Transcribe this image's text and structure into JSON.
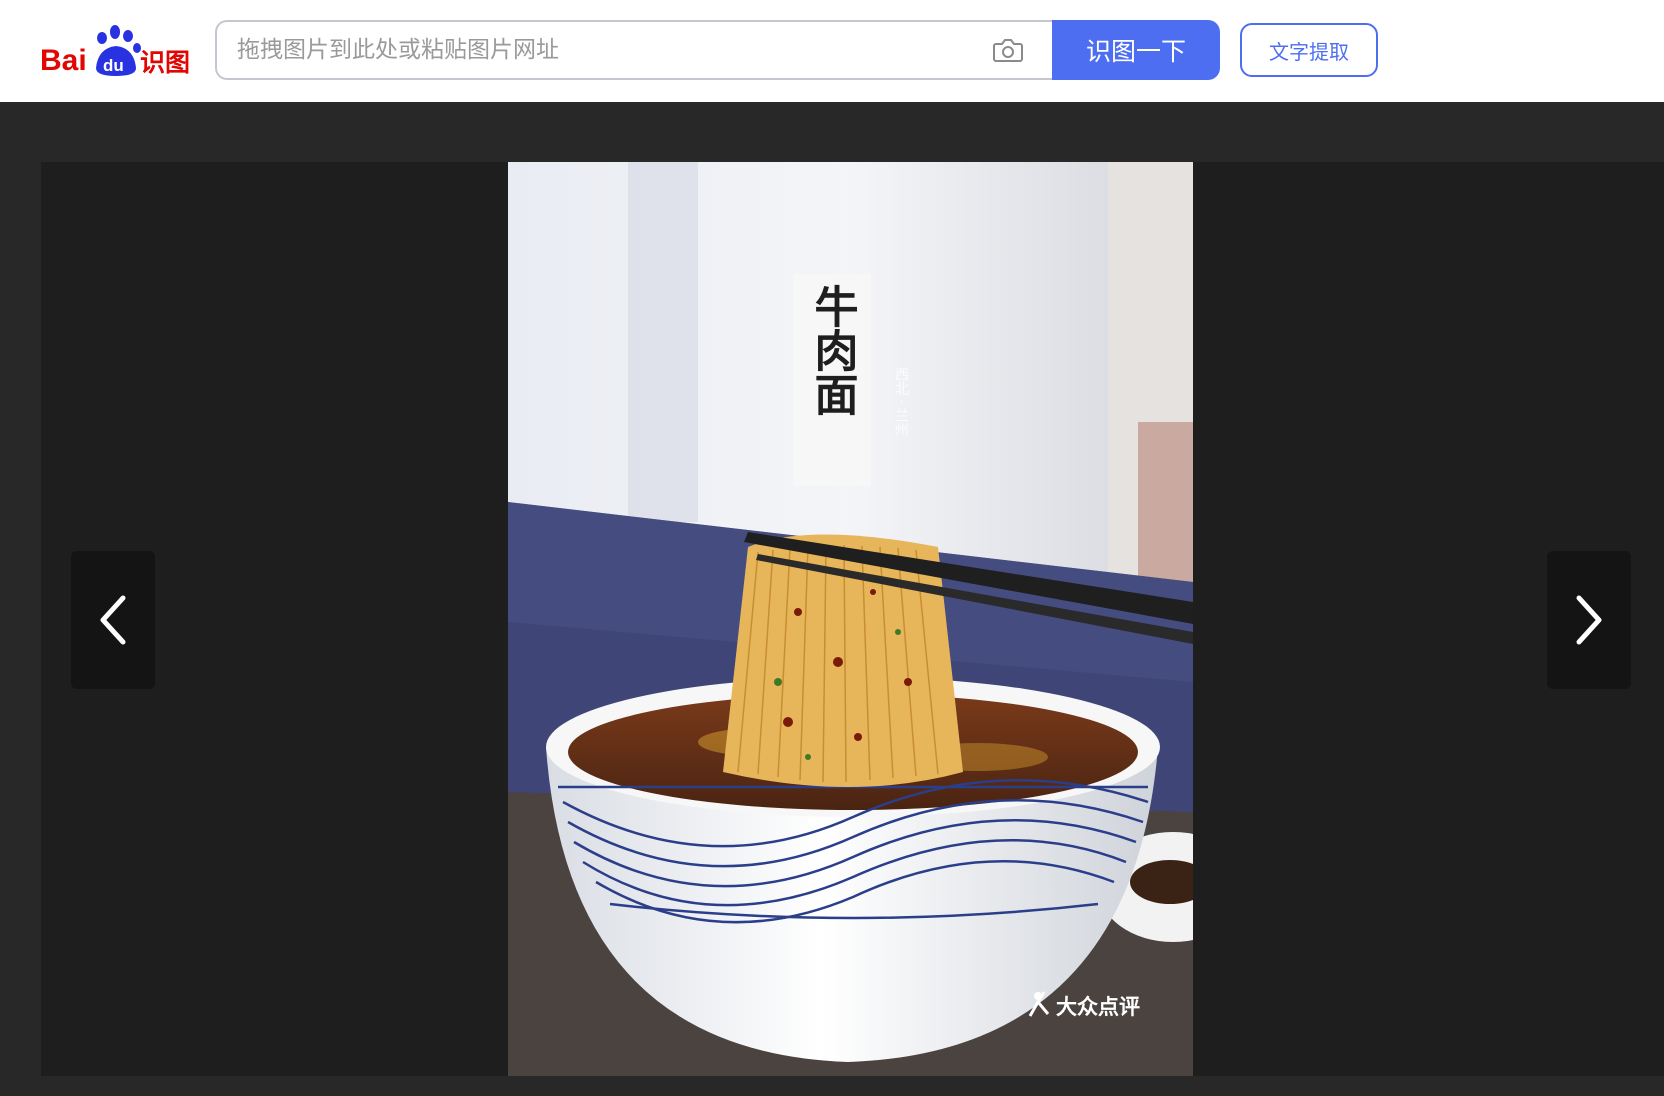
{
  "header": {
    "logo": {
      "text_bai": "Bai",
      "text_du": "du",
      "text_product": "识图"
    },
    "search": {
      "placeholder": "拖拽图片到此处或粘贴图片网址",
      "value": "",
      "button_label": "识图一下"
    },
    "ocr_button_label": "文字提取"
  },
  "viewer": {
    "image": {
      "title_vertical": "牛肉面",
      "subtitle_vertical": "西北 · 兰州",
      "watermark": "大众点评"
    },
    "prev_label": "previous-image",
    "next_label": "next-image"
  },
  "colors": {
    "accent": "#4e6ef2",
    "logo_red": "#e10602",
    "logo_blue": "#2932e1",
    "viewer_bg": "#1e1e1e",
    "page_bg": "#282828"
  },
  "icons": [
    "baidu-paw-icon",
    "camera-icon",
    "chevron-left-icon",
    "chevron-right-icon",
    "dianping-logo-icon"
  ]
}
